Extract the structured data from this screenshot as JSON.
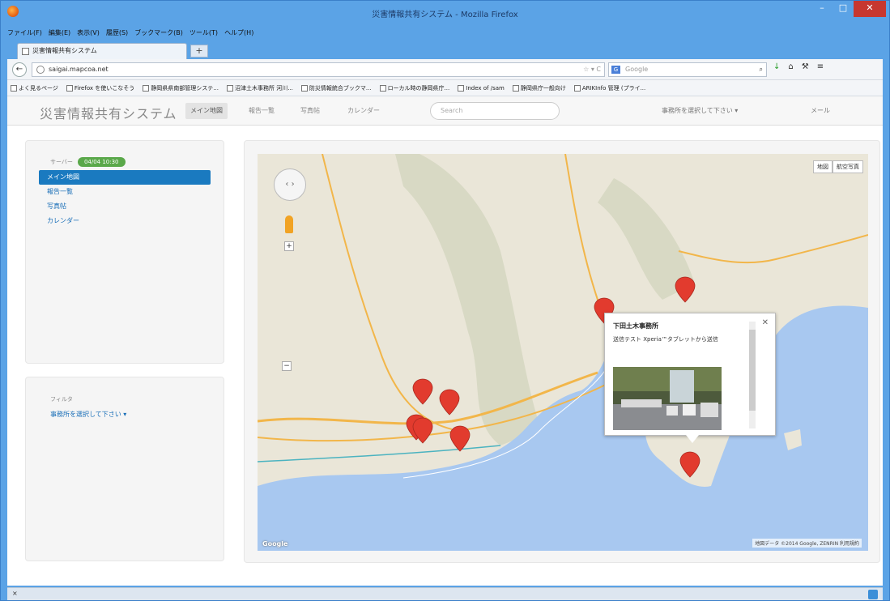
{
  "window": {
    "title": "災害情報共有システム - Mozilla Firefox",
    "controls": [
      "–",
      "□",
      "✕"
    ]
  },
  "menu": [
    "ファイル(F)",
    "編集(E)",
    "表示(V)",
    "履歴(S)",
    "ブックマーク(B)",
    "ツール(T)",
    "ヘルプ(H)"
  ],
  "tab": {
    "label": "災害情報共有システム",
    "new_tab": "+"
  },
  "navbar": {
    "back": "←",
    "url": "saigai.mapcoa.net",
    "url_icons": "☆ ▾ C",
    "search_engine": "G",
    "search_placeholder": "Google",
    "search_icon": "⌕"
  },
  "bookmarks": [
    "よく見るページ",
    "Firefox を使いこなそう",
    "静岡県県南部管理システ...",
    "沼津土木事務所 河川...",
    "防災情報統合ブックマ...",
    "ローカル時の静岡県庁...",
    "Index of /sam",
    "静岡県庁一般向け",
    "ARIKInfo 管理 (プライ..."
  ],
  "app": {
    "brand": "災害情報共有システム",
    "nav": [
      "メイン地図",
      "報告一覧",
      "写真帖",
      "カレンダー"
    ],
    "search_placeholder": "Search",
    "office_selector": "事務所を選択して下さい ▾",
    "mail": "メール"
  },
  "sidebar": {
    "server_label": "サーバー",
    "server_badge": "04/04 10:30",
    "items": [
      "メイン地図",
      "報告一覧",
      "写真帖",
      "カレンダー"
    ],
    "active_index": 0
  },
  "filter": {
    "label": "フィルタ",
    "select": "事務所を選択して下さい ▾"
  },
  "map": {
    "type_buttons": [
      "地図",
      "航空写真"
    ],
    "pan_icon": "‹ ›",
    "zoom_plus": "+",
    "zoom_minus": "−",
    "attribution": "地図データ ©2014 Google, ZENRIN  利用規約",
    "logo": "Google",
    "colors": {
      "sea": "#a8c8f0",
      "land": "#eae6d8",
      "mountain": "#d8d9c4",
      "road": "#f2b64a",
      "marker": "#e23b2e"
    },
    "info": {
      "title": "下田土木事務所",
      "text": "送信テスト Xperia™タブレットから送信",
      "close": "✕"
    }
  },
  "status": {
    "left": "×"
  }
}
